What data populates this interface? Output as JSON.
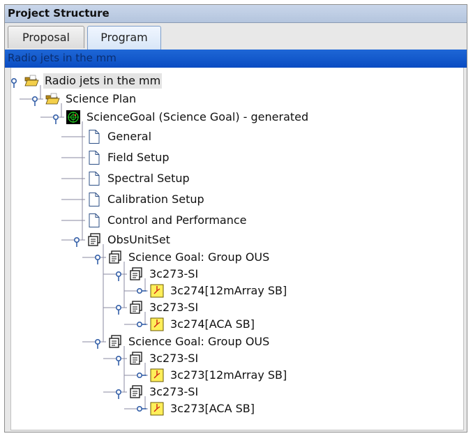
{
  "panel": {
    "title": "Project Structure"
  },
  "tabs": [
    {
      "label": "Proposal",
      "active": false
    },
    {
      "label": "Program",
      "active": true
    }
  ],
  "tree_header": "Radio jets in the mm",
  "colors": {
    "header_blue": "#0a4cc2",
    "tree_line": "#8a8aa0",
    "toggle_blue": "#3560a8",
    "sb_yellow": "#ffef5a"
  },
  "tree": {
    "nodes": [
      {
        "id": "root",
        "label": "Radio jets in the mm",
        "icon": "open-folder-icon",
        "depth": 0,
        "expanded": true,
        "selected": true
      },
      {
        "id": "science-plan",
        "label": "Science Plan",
        "icon": "open-folder-icon",
        "depth": 1,
        "expanded": true
      },
      {
        "id": "science-goal",
        "label": "ScienceGoal (Science Goal) - generated",
        "icon": "science-goal-icon",
        "depth": 2,
        "expanded": true
      },
      {
        "id": "general",
        "label": "General",
        "icon": "document-icon",
        "depth": 3
      },
      {
        "id": "field-setup",
        "label": "Field Setup",
        "icon": "document-icon",
        "depth": 3
      },
      {
        "id": "spectral-setup",
        "label": "Spectral Setup",
        "icon": "document-icon",
        "depth": 3
      },
      {
        "id": "calibration-setup",
        "label": "Calibration Setup",
        "icon": "document-icon",
        "depth": 3
      },
      {
        "id": "control-performance",
        "label": "Control and Performance",
        "icon": "document-icon",
        "depth": 3
      },
      {
        "id": "obsunitset",
        "label": "ObsUnitSet",
        "icon": "obsunitset-icon",
        "depth": 3,
        "expanded": true
      },
      {
        "id": "group-ous-1",
        "label": "Science Goal: Group OUS",
        "icon": "obsunitset-icon",
        "depth": 4,
        "expanded": true
      },
      {
        "id": "mous-1",
        "label": "3c273-SI",
        "icon": "obsunitset-icon",
        "depth": 5,
        "expanded": true
      },
      {
        "id": "sb-1",
        "label": "3c274[12mArray SB]",
        "icon": "scheduling-block-icon",
        "depth": 6
      },
      {
        "id": "mous-2",
        "label": "3c273-SI",
        "icon": "obsunitset-icon",
        "depth": 5,
        "expanded": true
      },
      {
        "id": "sb-2",
        "label": "3c274[ACA SB]",
        "icon": "scheduling-block-icon",
        "depth": 6
      },
      {
        "id": "group-ous-2",
        "label": "Science Goal: Group OUS",
        "icon": "obsunitset-icon",
        "depth": 4,
        "expanded": true
      },
      {
        "id": "mous-3",
        "label": "3c273-SI",
        "icon": "obsunitset-icon",
        "depth": 5,
        "expanded": true
      },
      {
        "id": "sb-3",
        "label": "3c273[12mArray SB]",
        "icon": "scheduling-block-icon",
        "depth": 6
      },
      {
        "id": "mous-4",
        "label": "3c273-SI",
        "icon": "obsunitset-icon",
        "depth": 5,
        "expanded": true
      },
      {
        "id": "sb-4",
        "label": "3c273[ACA SB]",
        "icon": "scheduling-block-icon",
        "depth": 6
      }
    ]
  }
}
